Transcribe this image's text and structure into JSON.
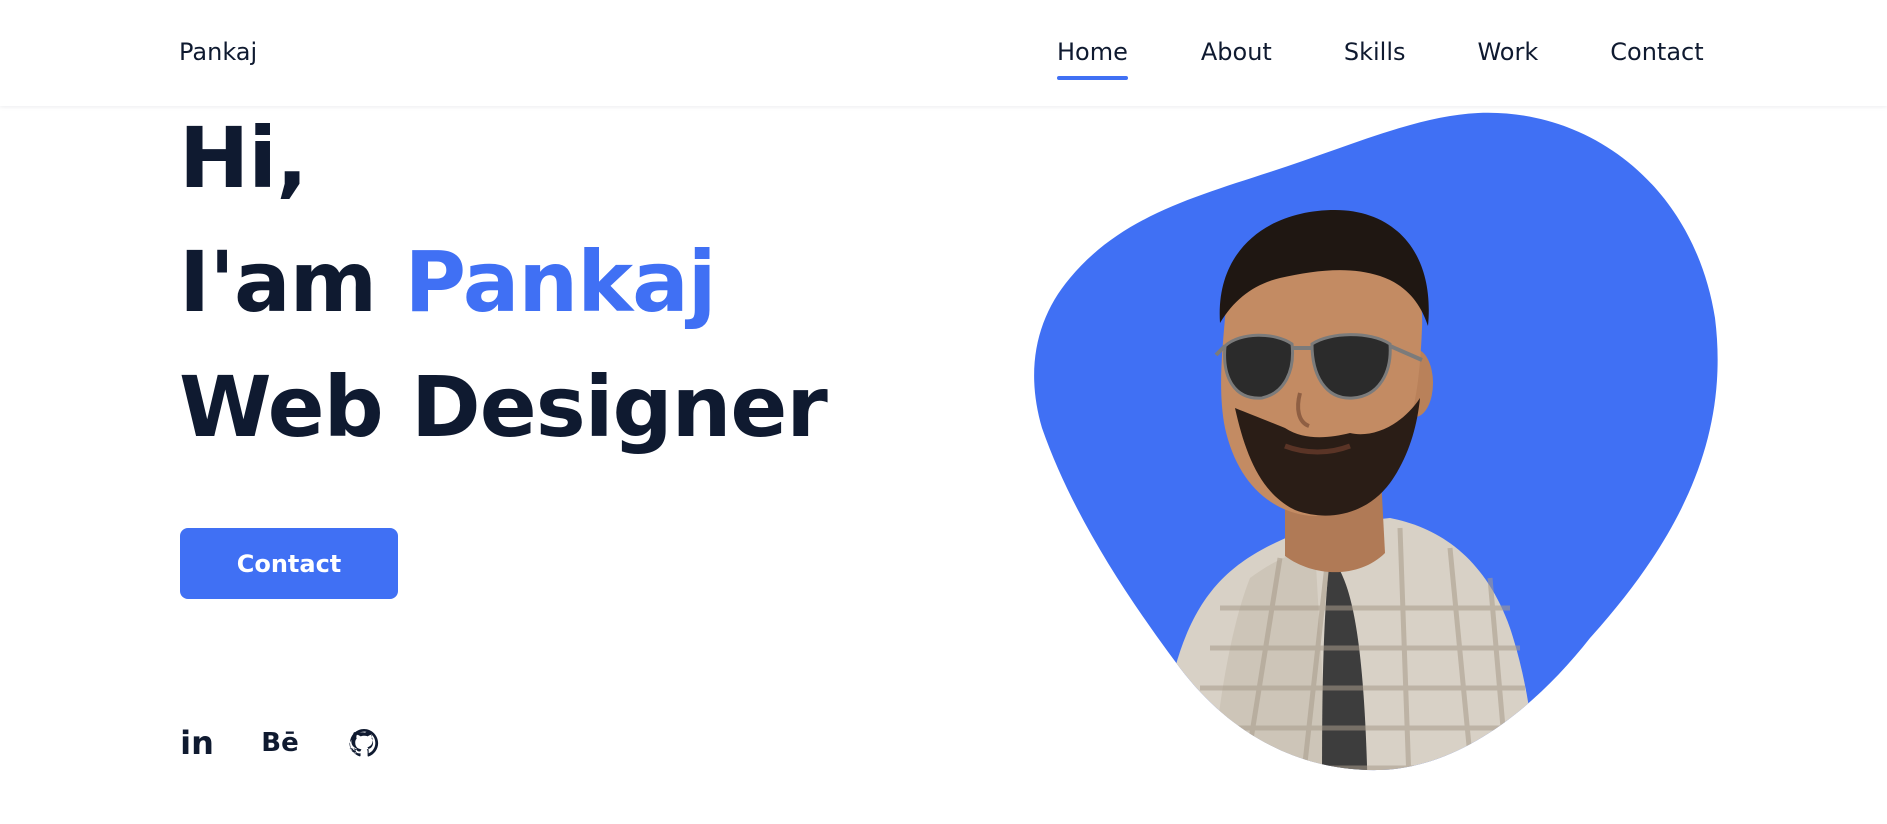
{
  "header": {
    "logo": "Pankaj",
    "nav": [
      {
        "label": "Home",
        "active": true
      },
      {
        "label": "About",
        "active": false
      },
      {
        "label": "Skills",
        "active": false
      },
      {
        "label": "Work",
        "active": false
      },
      {
        "label": "Contact",
        "active": false
      }
    ]
  },
  "hero": {
    "line1": "Hi,",
    "line2_prefix": "I'am ",
    "line2_name": "Pankaj",
    "line3": "Web Designer",
    "cta_label": "Contact"
  },
  "social": {
    "linkedin_label": "in",
    "behance_label": "Bē"
  },
  "colors": {
    "accent": "#4070f4",
    "text_dark": "#0f1a30",
    "background": "#ffffff"
  },
  "icons": {
    "linkedin": "linkedin-icon",
    "behance": "behance-icon",
    "github": "github-icon"
  },
  "image": {
    "alt": "Portrait of Pankaj in sunglasses on a blue blob background"
  }
}
